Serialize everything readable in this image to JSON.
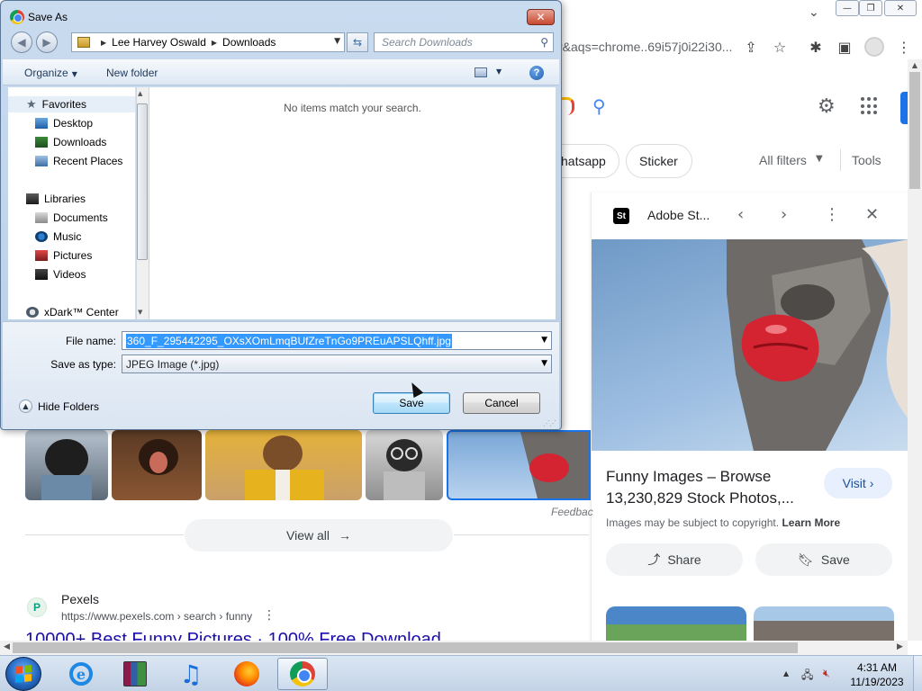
{
  "browser": {
    "omnibox_text": "r&aqs=chrome..69i57j0i22i30...",
    "window_controls": [
      "minimize",
      "restore",
      "close"
    ]
  },
  "search": {
    "chips": [
      "hatsapp",
      "Sticker"
    ],
    "all_filters": "All filters",
    "tools": "Tools"
  },
  "panel": {
    "source": "Adobe St...",
    "title": "Funny Images – Browse 13,230,829 Stock Photos,...",
    "visit": "Visit",
    "copyright": "Images may be subject to copyright.",
    "learn_more": "Learn More",
    "share": "Share",
    "save": "Save"
  },
  "results": {
    "feedback": "Feedbac",
    "view_all": "View all",
    "site_name": "Pexels",
    "site_url": "https://www.pexels.com › search › funny",
    "result_title": "10000+ Best Funny Pictures · 100% Free Download"
  },
  "dialog": {
    "title": "Save As",
    "breadcrumb": [
      "Lee Harvey Oswald",
      "Downloads"
    ],
    "search_placeholder": "Search Downloads",
    "organize": "Organize",
    "new_folder": "New folder",
    "nav_items": [
      {
        "label": "Favorites"
      },
      {
        "label": "Desktop"
      },
      {
        "label": "Downloads"
      },
      {
        "label": "Recent Places"
      },
      {
        "label": "Libraries"
      },
      {
        "label": "Documents"
      },
      {
        "label": "Music"
      },
      {
        "label": "Pictures"
      },
      {
        "label": "Videos"
      },
      {
        "label": "xDark™ Center"
      }
    ],
    "empty_message": "No items match your search.",
    "file_name_label": "File name:",
    "file_name_value": "360_F_295442295_OXsXOmLmqBUfZreTnGo9PREuAPSLQhff.jpg",
    "save_type_label": "Save as type:",
    "save_type_value": "JPEG Image (*.jpg)",
    "hide_folders": "Hide Folders",
    "save_button": "Save",
    "cancel_button": "Cancel"
  },
  "taskbar": {
    "time": "4:31 AM",
    "date": "11/19/2023"
  },
  "colors": {
    "link": "#1a0dab",
    "accent": "#1a73e8",
    "selection": "#3399ff"
  }
}
